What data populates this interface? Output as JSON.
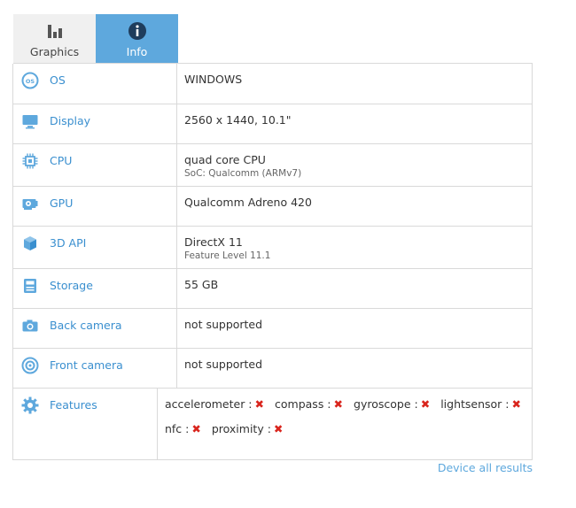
{
  "tabs": [
    {
      "label": "Graphics",
      "icon": "bar-chart-icon",
      "active": false
    },
    {
      "label": "Info",
      "icon": "info-icon",
      "active": true
    }
  ],
  "rows": [
    {
      "label": "OS",
      "icon": "os-icon",
      "value": "WINDOWS",
      "sub": ""
    },
    {
      "label": "Display",
      "icon": "monitor-icon",
      "value": "2560 x 1440, 10.1\"",
      "sub": ""
    },
    {
      "label": "CPU",
      "icon": "cpu-chip-icon",
      "value": "quad core CPU",
      "sub": "SoC: Qualcomm (ARMv7)"
    },
    {
      "label": "GPU",
      "icon": "gpu-icon",
      "value": "Qualcomm Adreno 420",
      "sub": ""
    },
    {
      "label": "3D API",
      "icon": "cube-icon",
      "value": "DirectX 11",
      "sub": "Feature Level 11.1"
    },
    {
      "label": "Storage",
      "icon": "storage-icon",
      "value": "55 GB",
      "sub": ""
    },
    {
      "label": "Back camera",
      "icon": "camera-icon",
      "value": "not supported",
      "sub": ""
    },
    {
      "label": "Front camera",
      "icon": "front-camera-icon",
      "value": "not supported",
      "sub": ""
    },
    {
      "label": "Features",
      "icon": "gear-icon",
      "value": "",
      "sub": ""
    }
  ],
  "features": [
    {
      "name": "accelerometer :",
      "supported": false
    },
    {
      "name": "compass :",
      "supported": false
    },
    {
      "name": "gyroscope :",
      "supported": false
    },
    {
      "name": "lightsensor :",
      "supported": false
    },
    {
      "name": "nfc :",
      "supported": false
    },
    {
      "name": "proximity :",
      "supported": false
    }
  ],
  "feature_unsupported_mark": "✖",
  "footer": {
    "link": "Device all results"
  },
  "colors": {
    "accent": "#5ea8dd",
    "link": "#3a8fcf",
    "unsupported": "#d9251d",
    "border": "#d9d9d9",
    "tab_inactive": "#f0f0f0"
  }
}
